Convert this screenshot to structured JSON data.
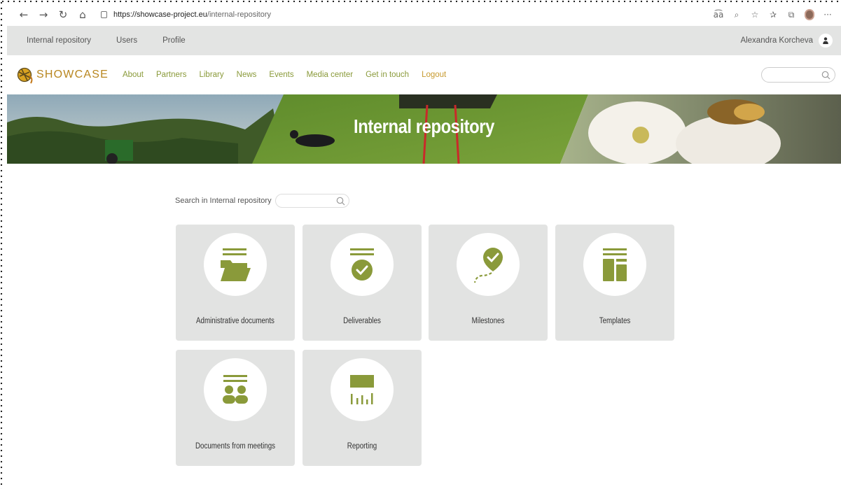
{
  "browser": {
    "url_domain": "https://showcase-project.eu",
    "url_path": "/internal-repository"
  },
  "topbar": {
    "items": [
      "Internal repository",
      "Users",
      "Profile"
    ],
    "user_name": "Alexandra Korcheva"
  },
  "nav": {
    "logo_text": "SHOWCASE",
    "items": [
      "About",
      "Partners",
      "Library",
      "News",
      "Events",
      "Media center",
      "Get in touch"
    ],
    "logout": "Logout"
  },
  "hero": {
    "title": "Internal repository"
  },
  "search": {
    "label": "Search in Internal repository"
  },
  "cards": [
    {
      "label": "Administrative documents",
      "icon": "folder-icon"
    },
    {
      "label": "Deliverables",
      "icon": "check-badge-icon"
    },
    {
      "label": "Milestones",
      "icon": "map-pin-check-icon"
    },
    {
      "label": "Templates",
      "icon": "layout-template-icon"
    },
    {
      "label": "Documents from meetings",
      "icon": "people-icon"
    },
    {
      "label": "Reporting",
      "icon": "bar-chart-icon"
    }
  ],
  "colors": {
    "accent": "#8a9a3a",
    "logout": "#c79a2f",
    "card_bg": "#e2e3e2",
    "topbar_bg": "#e3e4e3"
  }
}
